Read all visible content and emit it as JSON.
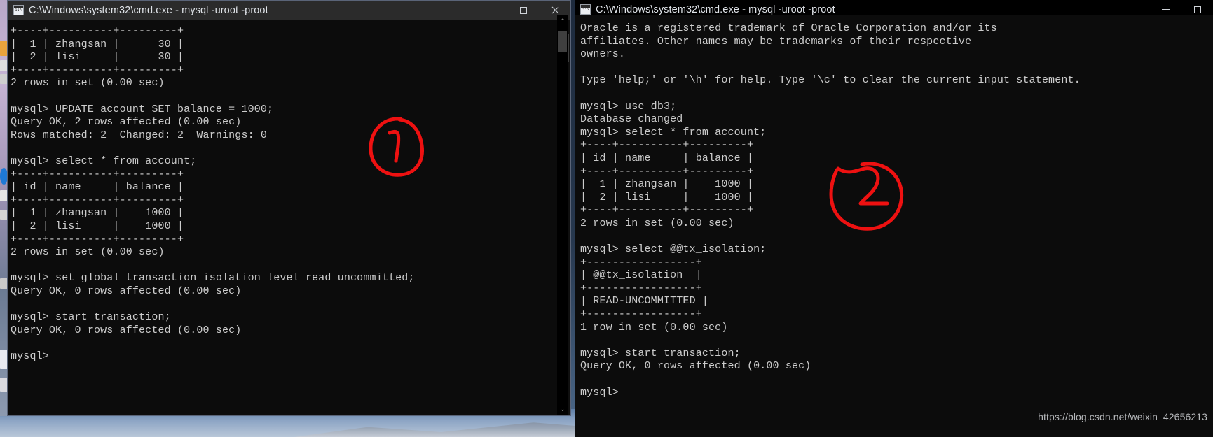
{
  "desktop": {
    "taskbar_icons": [
      "explorer-icon",
      "orange-app-icon",
      "edge-icon",
      "mysql-icon",
      "ime-icon",
      "cmd-icon"
    ]
  },
  "window_left": {
    "title": "C:\\Windows\\system32\\cmd.exe - mysql  -uroot -proot",
    "icon": "cmd-icon",
    "controls": {
      "minimize": "—",
      "maximize": "□",
      "close": "✕"
    },
    "scrollbar": {
      "up_arrow": "⌃",
      "down_arrow": "⌄"
    },
    "terminal_text": "+----+----------+---------+\n|  1 | zhangsan |      30 |\n|  2 | lisi     |      30 |\n+----+----------+---------+\n2 rows in set (0.00 sec)\n\nmysql> UPDATE account SET balance = 1000;\nQuery OK, 2 rows affected (0.00 sec)\nRows matched: 2  Changed: 2  Warnings: 0\n\nmysql> select * from account;\n+----+----------+---------+\n| id | name     | balance |\n+----+----------+---------+\n|  1 | zhangsan |    1000 |\n|  2 | lisi     |    1000 |\n+----+----------+---------+\n2 rows in set (0.00 sec)\n\nmysql> set global transaction isolation level read uncommitted;\nQuery OK, 0 rows affected (0.00 sec)\n\nmysql> start transaction;\nQuery OK, 0 rows affected (0.00 sec)\n\nmysql>"
  },
  "window_right": {
    "title": "C:\\Windows\\system32\\cmd.exe - mysql  -uroot -proot",
    "icon": "cmd-icon",
    "controls": {
      "minimize": "—",
      "maximize": "□"
    },
    "scrollbar": {
      "up_arrow": "⌃",
      "down_arrow": "⌄"
    },
    "terminal_text": "Oracle is a registered trademark of Oracle Corporation and/or its\naffiliates. Other names may be trademarks of their respective\nowners.\n\nType 'help;' or '\\h' for help. Type '\\c' to clear the current input statement.\n\nmysql> use db3;\nDatabase changed\nmysql> select * from account;\n+----+----------+---------+\n| id | name     | balance |\n+----+----------+---------+\n|  1 | zhangsan |    1000 |\n|  2 | lisi     |    1000 |\n+----+----------+---------+\n2 rows in set (0.00 sec)\n\nmysql> select @@tx_isolation;\n+-----------------+\n| @@tx_isolation  |\n+-----------------+\n| READ-UNCOMMITTED |\n+-----------------+\n1 row in set (0.00 sec)\n\nmysql> start transaction;\nQuery OK, 0 rows affected (0.00 sec)\n\nmysql>"
  },
  "annotations": {
    "color": "#ee1111",
    "marks": [
      {
        "name": "circle-one",
        "label": "1"
      },
      {
        "name": "circle-two",
        "label": "2"
      }
    ]
  },
  "watermark": "https://blog.csdn.net/weixin_42656213"
}
